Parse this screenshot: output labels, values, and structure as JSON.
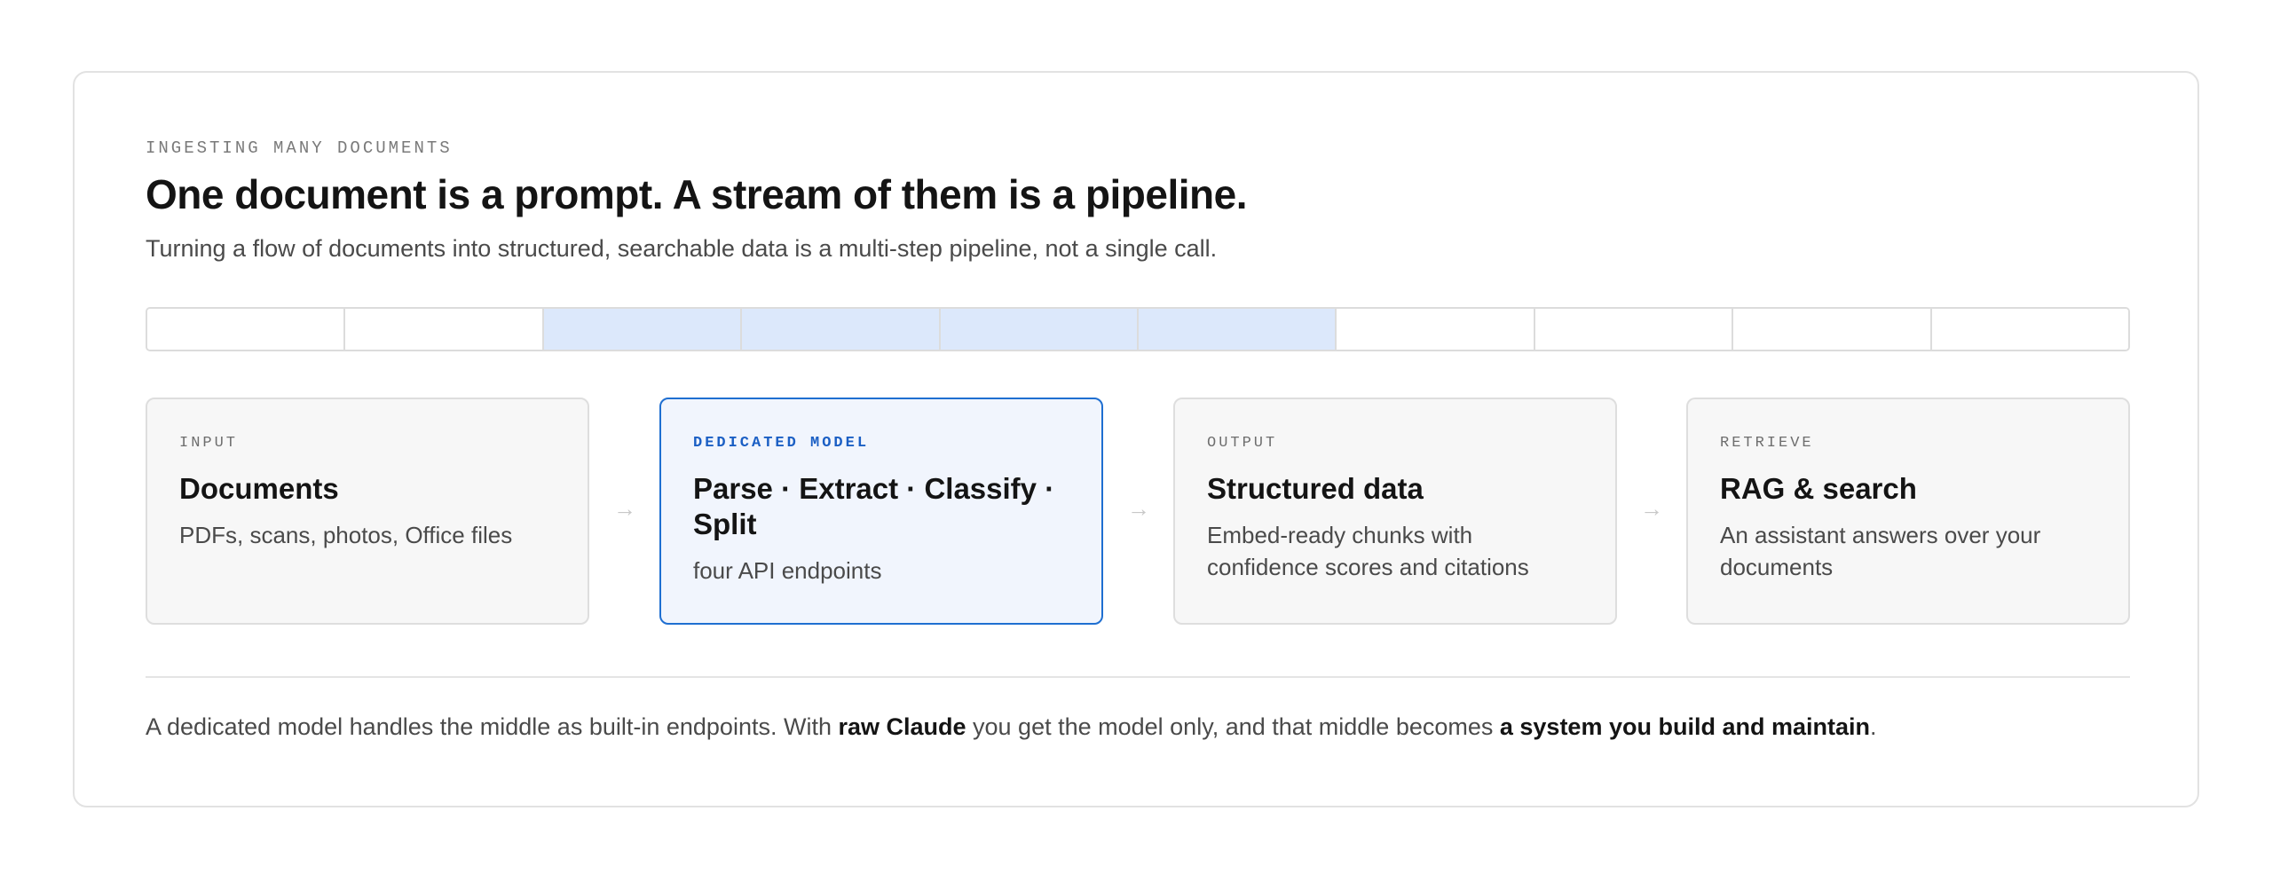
{
  "header": {
    "eyebrow": "INGESTING MANY DOCUMENTS",
    "title": "One document is a prompt. A stream of them is a pipeline.",
    "subtitle": "Turning a flow of documents into structured, searchable data is a multi-step pipeline, not a single call."
  },
  "strip": {
    "segment_count": 10,
    "highlighted_segments": [
      3,
      4,
      5,
      6
    ],
    "highlight_color": "#dce8fb"
  },
  "pipeline": {
    "arrow_glyph": "→",
    "steps": [
      {
        "label": "INPUT",
        "heading": "Documents",
        "description": "PDFs, scans, photos, Office files"
      },
      {
        "label": "DEDICATED MODEL",
        "heading": "Parse · Extract · Classify · Split",
        "description": "four API endpoints"
      },
      {
        "label": "OUTPUT",
        "heading": "Structured data",
        "description": "Embed-ready chunks with confidence scores and citations"
      },
      {
        "label": "RETRIEVE",
        "heading": "RAG & search",
        "description": "An assistant answers over your documents"
      }
    ]
  },
  "footer": {
    "text_1": "A dedicated model handles the middle as built-in endpoints. With ",
    "bold_1": "raw Claude",
    "text_2": " you get the model only, and that middle becomes ",
    "bold_2": "a system you build and maintain",
    "text_3": "."
  },
  "colors": {
    "accent": "#1f6fd1",
    "accent_label": "#1b5fc4",
    "highlight_card_bg": "#f1f5fd",
    "card_bg": "#f7f7f7"
  }
}
